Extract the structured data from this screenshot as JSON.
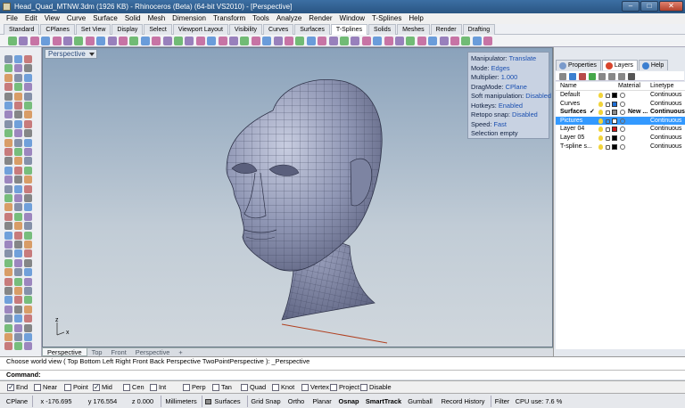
{
  "window": {
    "title": "Head_Quad_MTNW.3dm (1926 KB) - Rhinoceros (Beta) (64-bit VS2010) - [Perspective]",
    "minimize": "–",
    "maximize": "□",
    "close": "✕"
  },
  "menu": [
    "File",
    "Edit",
    "View",
    "Curve",
    "Surface",
    "Solid",
    "Mesh",
    "Dimension",
    "Transform",
    "Tools",
    "Analyze",
    "Render",
    "Window",
    "T-Splines",
    "Help"
  ],
  "toolbar_tabs": [
    "Standard",
    "CPlanes",
    "Set View",
    "Display",
    "Select",
    "Viewport Layout",
    "Visibility",
    "Curves",
    "Surfaces",
    "T-Splines",
    "Solids",
    "Meshes",
    "Render",
    "Drafting"
  ],
  "active_toolbar_tab": "T-Splines",
  "viewport": {
    "label": "Perspective",
    "axis_y": "z",
    "axis_x": "x",
    "tsplines": [
      {
        "k": "Manipulator:",
        "v": "Translate"
      },
      {
        "k": "Mode:",
        "v": "Edges"
      },
      {
        "k": "Multiplier:",
        "v": "1.000"
      },
      {
        "k": "DragMode:",
        "v": "CPlane"
      },
      {
        "k": "Soft manipulation:",
        "v": "Disabled"
      },
      {
        "k": "Hotkeys:",
        "v": "Enabled"
      },
      {
        "k": "Retopo snap:",
        "v": "Disabled"
      },
      {
        "k": "Speed:",
        "v": "Fast"
      },
      {
        "k": "Selection empty",
        "v": ""
      }
    ]
  },
  "viewport_tabs": [
    "Perspective",
    "Top",
    "Front",
    "Perspective",
    "+"
  ],
  "panel": {
    "tabs": [
      "Properties",
      "Layers",
      "Help"
    ],
    "active_tab": "Layers",
    "columns": {
      "name": "Name",
      "material": "Material",
      "linetype": "Linetype"
    },
    "layers": [
      {
        "name": "Default",
        "color": "#000000",
        "material": "",
        "linetype": "Continuous",
        "current": false,
        "selected": false,
        "check": ""
      },
      {
        "name": "Curves",
        "color": "#1f6fd6",
        "material": "",
        "linetype": "Continuous",
        "current": false,
        "selected": false,
        "check": ""
      },
      {
        "name": "Surfaces",
        "color": "#8c8c8c",
        "material": "New ...",
        "linetype": "Continuous",
        "current": true,
        "selected": false,
        "check": "✓"
      },
      {
        "name": "Pictures",
        "color": "#ffffff",
        "material": "",
        "linetype": "Continuous",
        "current": false,
        "selected": true,
        "check": ""
      },
      {
        "name": "Layer 04",
        "color": "#d01818",
        "material": "",
        "linetype": "Continuous",
        "current": false,
        "selected": false,
        "check": ""
      },
      {
        "name": "Layer 05",
        "color": "#000000",
        "material": "",
        "linetype": "Continuous",
        "current": false,
        "selected": false,
        "check": ""
      },
      {
        "name": "T-spline s...",
        "color": "#000000",
        "material": "",
        "linetype": "Continuous",
        "current": false,
        "selected": false,
        "check": ""
      }
    ]
  },
  "command": {
    "history": "Choose world view ( Top  Bottom  Left  Right  Front  Back  Perspective  TwoPointPerspective ): _Perspective",
    "prompt": "Command:"
  },
  "osnaps": [
    {
      "label": "End",
      "on": true
    },
    {
      "label": "Near",
      "on": false
    },
    {
      "label": "Point",
      "on": false
    },
    {
      "label": "Mid",
      "on": true
    },
    {
      "label": "Cen",
      "on": false
    },
    {
      "label": "Int",
      "on": false
    },
    {
      "label": "Perp",
      "on": false
    },
    {
      "label": "Tan",
      "on": false
    },
    {
      "label": "Quad",
      "on": false
    },
    {
      "label": "Knot",
      "on": false
    },
    {
      "label": "Vertex",
      "on": false
    },
    {
      "label": "Project",
      "on": false
    },
    {
      "label": "Disable",
      "on": false
    }
  ],
  "status": {
    "cplane": "CPlane",
    "x": "x -176.695",
    "y": "y 176.554",
    "z": "z 0.000",
    "units": "Millimeters",
    "layer": "Surfaces",
    "grid_snap": "Grid Snap",
    "ortho": "Ortho",
    "planar": "Planar",
    "osnap": "Osnap",
    "smarttrack": "SmartTrack",
    "gumball": "Gumball",
    "record_history": "Record History",
    "filter": "Filter",
    "cpu": "CPU use: 7.6 %"
  },
  "colors": {
    "accent": "#3399ff",
    "title": "#2a5583",
    "viewport_top": "#8aa2bb",
    "mesh": "#8f96b4"
  }
}
